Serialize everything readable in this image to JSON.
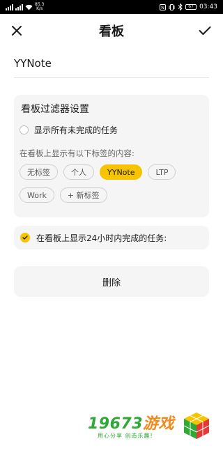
{
  "status_bar": {
    "net_speed": "85.3",
    "net_unit": "K/s",
    "battery": "67",
    "time": "03:43"
  },
  "header": {
    "title": "看板",
    "close_icon": "close-icon",
    "confirm_icon": "check-icon"
  },
  "board_name": {
    "value": "YYNote"
  },
  "filter": {
    "title": "看板过滤器设置",
    "show_all_unfinished": {
      "label": "显示所有未完成的任务",
      "checked": false
    },
    "tags_label": "在看板上显示有以下标签的内容:",
    "tags": [
      {
        "label": "无标签",
        "selected": false
      },
      {
        "label": "个人",
        "selected": false
      },
      {
        "label": "YYNote",
        "selected": true
      },
      {
        "label": "LTP",
        "selected": false
      },
      {
        "label": "Work",
        "selected": false
      },
      {
        "label": "+  新标签",
        "selected": false
      }
    ]
  },
  "completed_24h": {
    "label": "在看板上显示24小时内完成的任务:",
    "checked": true
  },
  "delete_button": {
    "label": "删除"
  },
  "watermark": {
    "text_green": "19673",
    "text_orange": "游戏",
    "slogan": "用心分享 创造乐趣!"
  },
  "colors": {
    "accent": "#f6c400",
    "card_bg": "#f5f5f5",
    "watermark_green": "#2fa836",
    "watermark_orange": "#f08a1c"
  }
}
